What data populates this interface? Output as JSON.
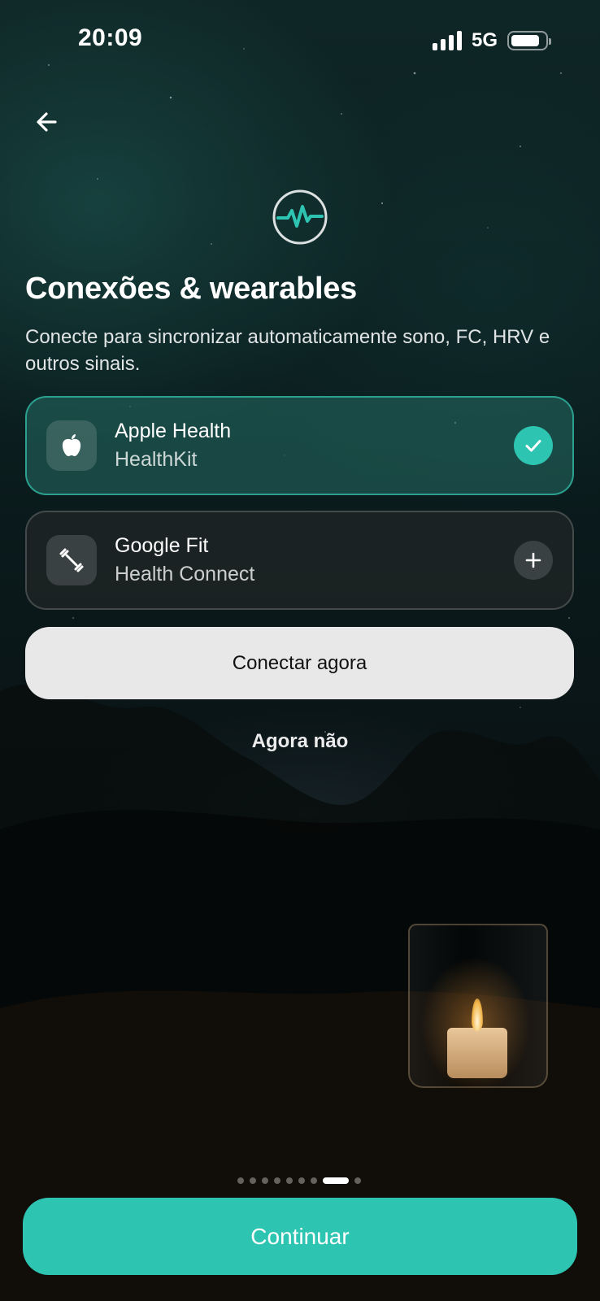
{
  "status_bar": {
    "time": "20:09",
    "network": "5G"
  },
  "header": {
    "back_icon": "arrow-left-icon",
    "logo_icon": "heartbeat-pulse-icon"
  },
  "title": "Conexões & wearables",
  "subtitle": "Conecte para sincronizar automaticamente sono, FC, HRV e outros sinais.",
  "connections": [
    {
      "name": "Apple Health",
      "provider": "HealthKit",
      "icon": "apple-icon",
      "state": "connected",
      "status_icon": "check-icon"
    },
    {
      "name": "Google Fit",
      "provider": "Health Connect",
      "icon": "dumbbell-icon",
      "state": "not-connected",
      "status_icon": "plus-icon"
    }
  ],
  "buttons": {
    "connect_now": "Conectar agora",
    "not_now": "Agora não",
    "continue": "Continuar"
  },
  "pagination": {
    "total": 9,
    "current": 8
  },
  "colors": {
    "accent": "#2ec4b2",
    "button_light": "#e8e8e8"
  }
}
